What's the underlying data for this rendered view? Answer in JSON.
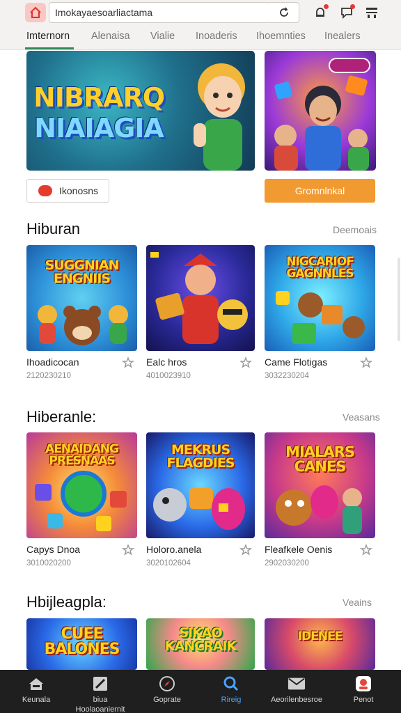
{
  "browser": {
    "url": "Imokayaesoarliactama",
    "home_icon": "home-icon",
    "reload_icon": "reload-icon",
    "notif_icon": "bell-icon",
    "chat_icon": "chat-icon",
    "menu_icon": "grid-menu-icon"
  },
  "tabs": [
    {
      "label": "Imternorn",
      "active": true
    },
    {
      "label": "Alenaisa",
      "active": false
    },
    {
      "label": "Vialie",
      "active": false
    },
    {
      "label": "Inoaderis",
      "active": false
    },
    {
      "label": "Ihoemnties",
      "active": false
    },
    {
      "label": "Inealers",
      "active": false
    }
  ],
  "hero": {
    "main_art_line1": "NIBRARQ",
    "main_art_line2": "NIAIAGIA",
    "outline_button": "Ikonosns",
    "orange_button": "Gromnlnkal"
  },
  "sections": [
    {
      "title": "Hiburan",
      "link": "Deemoais",
      "cards": [
        {
          "title": "Ihoadicocan",
          "sub": "2120230210",
          "art": "SUGGNIAN ENGNIIS"
        },
        {
          "title": "Ealc hros",
          "sub": "4010023910",
          "art": ""
        },
        {
          "title": "Came Flotigas",
          "sub": "3032230204",
          "art": "NIGCARIOF GAGNNLES"
        }
      ]
    },
    {
      "title": "Hiberanle:",
      "link": "Veasans",
      "cards": [
        {
          "title": "Capys Dnoa",
          "sub": "3010020200",
          "art": "AENAIDANG PRESNAAS"
        },
        {
          "title": "Holoro.anela",
          "sub": "3020102604",
          "art": "MEKRUS FLAGDIES"
        },
        {
          "title": "Fleafkele Oenis",
          "sub": "2902030200",
          "art": "MIALARS CANES"
        }
      ]
    },
    {
      "title": "Hbijleagpla:",
      "link": "Veains",
      "cards": [
        {
          "art": "CUEE BALONES"
        },
        {
          "art": "SIKAO KANCRAIK"
        },
        {
          "art": "IDENEE"
        }
      ]
    }
  ],
  "bottom_nav": [
    {
      "label": "Keunala",
      "icon": "house-icon",
      "active": false
    },
    {
      "label": "biua\nHoolaoaniernit",
      "icon": "brush-icon",
      "active": false
    },
    {
      "label": "Goprate",
      "icon": "compass-icon",
      "active": false
    },
    {
      "label": "Rireig",
      "icon": "search-icon",
      "active": true
    },
    {
      "label": "Aeorilenbesroe",
      "icon": "mail-icon",
      "active": false
    },
    {
      "label": "Penot",
      "icon": "profile-icon",
      "active": false
    }
  ],
  "colors": {
    "accent_green": "#2e8b57",
    "orange": "#f29a32",
    "nav_bg": "#1f1f1f",
    "active_blue": "#4aa3ff"
  }
}
